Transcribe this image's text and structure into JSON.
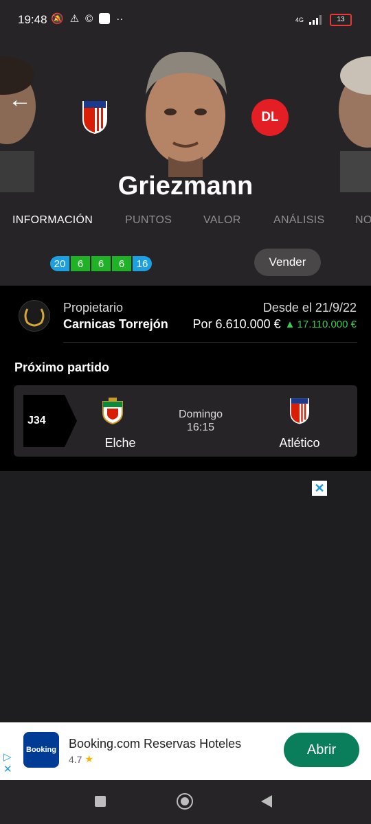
{
  "status_bar": {
    "time": "19:48",
    "network": "4G",
    "battery": "13"
  },
  "player": {
    "name": "Griezmann",
    "position": "DL",
    "club_crest": "atletico-crest"
  },
  "tabs": [
    {
      "label": "INFORMACIÓN",
      "active": true
    },
    {
      "label": "PUNTOS",
      "active": false
    },
    {
      "label": "VALOR",
      "active": false
    },
    {
      "label": "ANÁLISIS",
      "active": false
    },
    {
      "label": "NO",
      "active": false
    }
  ],
  "recent_points": [
    "20",
    "6",
    "6",
    "6",
    "16"
  ],
  "recent_points_colors": [
    "#1da0e0",
    "#1fb226",
    "#1fb226",
    "#1fb226",
    "#1da0e0"
  ],
  "sell_button": "Vender",
  "owner": {
    "label": "Propietario",
    "name": "Carnicas Torrejón",
    "since": "Desde el 21/9/22",
    "price": "Por 6.610.000 €",
    "change": "17.110.000 €",
    "change_color": "#3dcc56"
  },
  "next_match": {
    "title": "Próximo partido",
    "round": "J34",
    "home_team": "Elche",
    "away_team": "Atlético",
    "day": "Domingo",
    "time": "16:15"
  },
  "ad": {
    "close": "✕",
    "brand": "Booking",
    "title": "Booking.com Reservas Hoteles",
    "rating": "4.7",
    "cta": "Abrir"
  }
}
